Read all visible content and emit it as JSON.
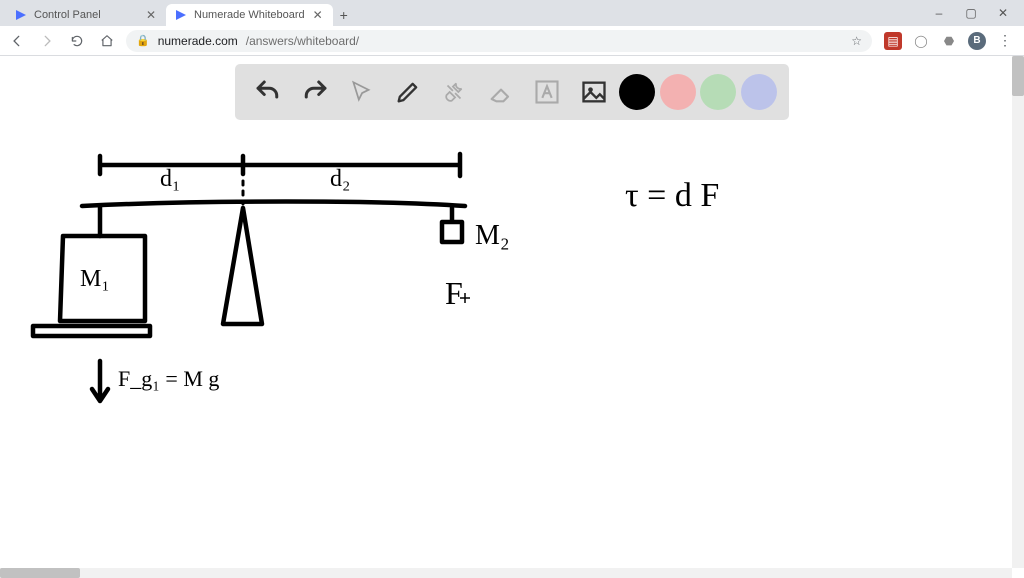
{
  "window": {
    "controls": {
      "minimize": "–",
      "maximize": "▢",
      "close": "✕"
    }
  },
  "tabs": [
    {
      "title": "Control Panel",
      "active": false
    },
    {
      "title": "Numerade Whiteboard",
      "active": true
    }
  ],
  "newtab_label": "+",
  "nav": {
    "back": "←",
    "forward": "→",
    "reload": "⟳",
    "home": "⌂"
  },
  "address": {
    "lock": "🔒",
    "host": "numerade.com",
    "path": "/answers/whiteboard/",
    "star": "☆"
  },
  "extensions": {
    "pdf": "▤",
    "circle": "◯",
    "shield": "⬣"
  },
  "avatar_initial": "B",
  "menu": "⋮",
  "whiteboard_tools": {
    "undo": "undo",
    "redo": "redo",
    "cursor": "cursor",
    "pen": "pen",
    "tools": "tools",
    "eraser": "eraser",
    "text": "text",
    "image": "image"
  },
  "colors": {
    "black": "#000000",
    "red": "#f3b1b1",
    "green": "#b6dcb6",
    "blue": "#bcc3ea"
  },
  "drawing_labels": {
    "d1": "d₁",
    "d2": "d₂",
    "M1": "M₁",
    "M2": "M₂",
    "F": "F",
    "Fg_eq": "F_g₁ = M g",
    "tau_eq": "τ = d F"
  },
  "icons": {
    "tab_close": "✕"
  }
}
